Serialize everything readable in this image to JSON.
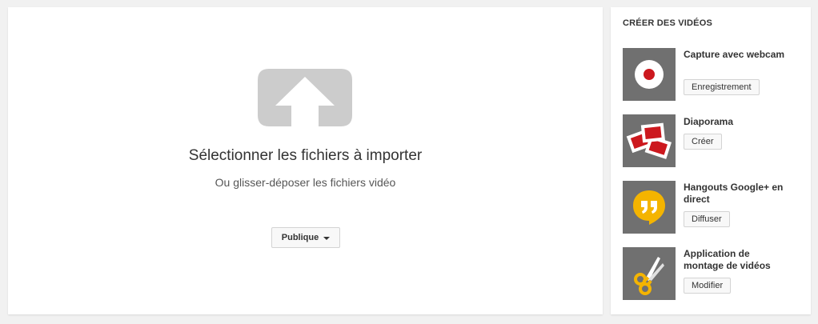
{
  "upload": {
    "title": "Sélectionner les fichiers à importer",
    "subtitle": "Ou glisser-déposer les fichiers vidéo",
    "privacy_label": "Publique",
    "icon": "upload-arrow-icon"
  },
  "create_videos": {
    "heading": "CRÉER DES VIDÉOS",
    "tools": [
      {
        "title": "Capture avec webcam",
        "button": "Enregistrement",
        "icon": "record-icon"
      },
      {
        "title": "Diaporama",
        "button": "Créer",
        "icon": "slideshow-icon"
      },
      {
        "title": "Hangouts Google+ en direct",
        "button": "Diffuser",
        "icon": "hangouts-icon"
      },
      {
        "title": "Application de montage de vidéos",
        "button": "Modifier",
        "icon": "scissors-icon"
      }
    ]
  },
  "colors": {
    "panel_bg": "#ffffff",
    "page_bg": "#f1f1f1",
    "thumb_bg": "#707070",
    "record_red": "#cc181e",
    "hangouts_yellow": "#f4b400"
  }
}
